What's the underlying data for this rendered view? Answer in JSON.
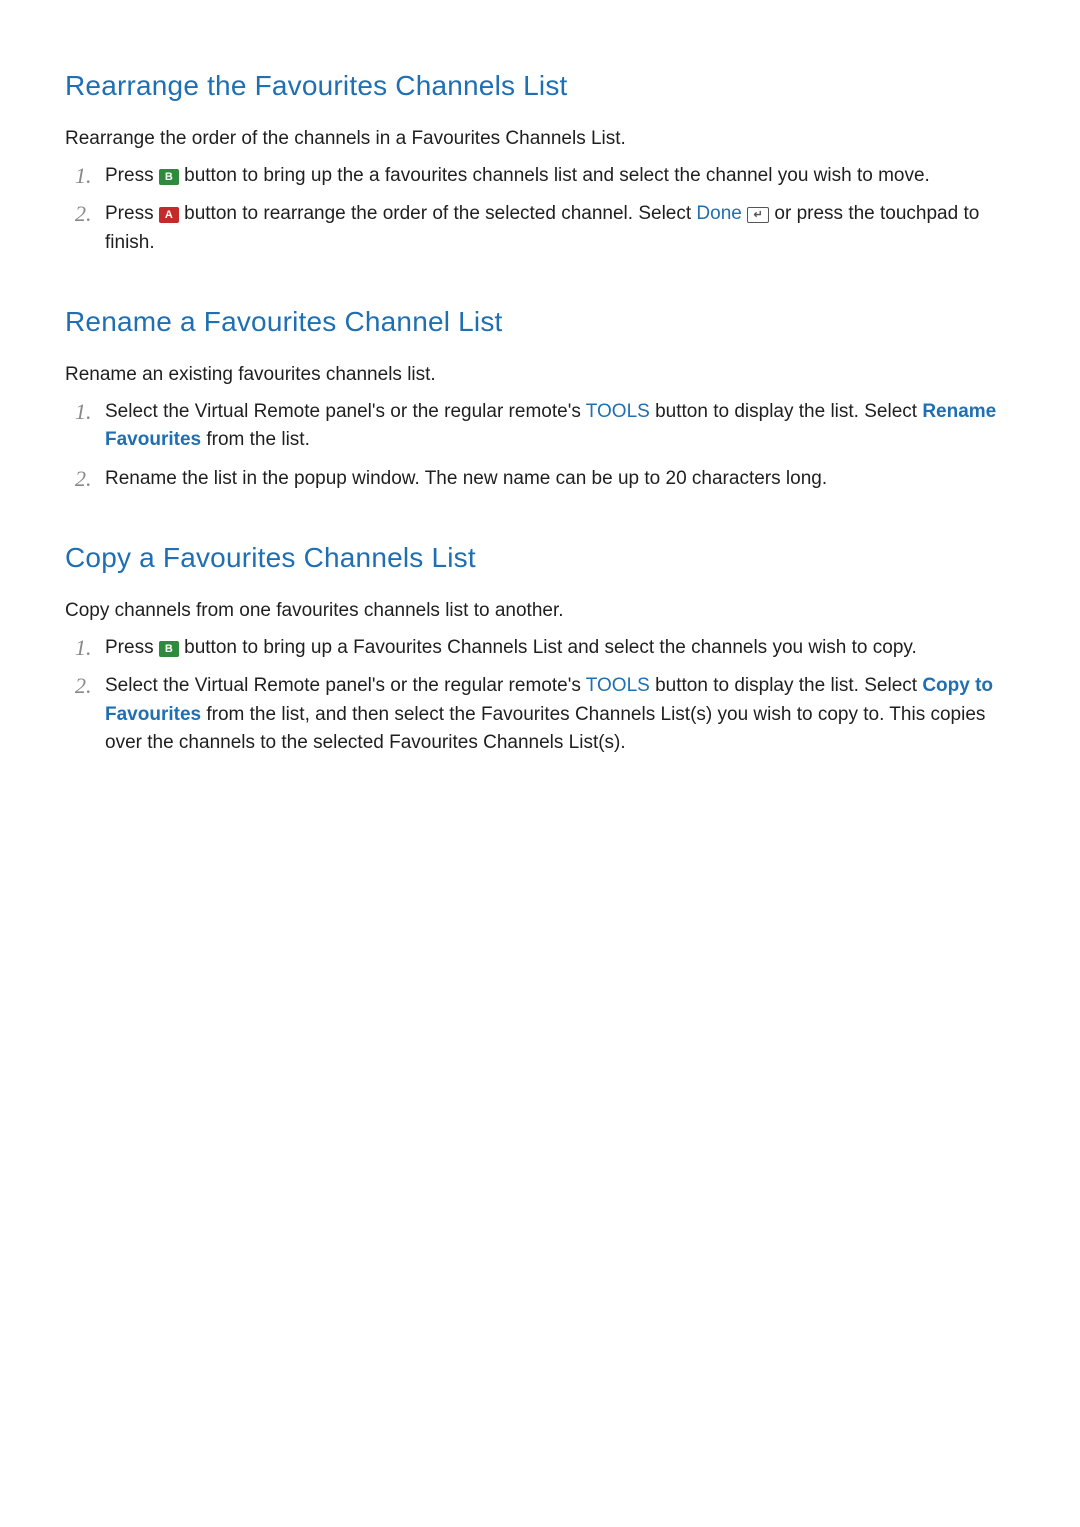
{
  "colors": {
    "heading": "#1f6fb2",
    "keyword_blue": "#1f6fb2",
    "btn_green": "#2e8b3d",
    "btn_red": "#c42a2a"
  },
  "sections": {
    "rearrange": {
      "heading": "Rearrange the Favourites Channels List",
      "intro": "Rearrange the order of the channels in a Favourites Channels List.",
      "step1": {
        "num": "1.",
        "t1": "Press ",
        "btnB": "B",
        "t2": " button to bring up the a favourites channels list and select the channel you wish to move."
      },
      "step2": {
        "num": "2.",
        "t1": "Press ",
        "btnA": "A",
        "t2": " button to rearrange the order of the selected channel. Select ",
        "done": "Done",
        "enter_glyph": "↵",
        "t3": " or press the touchpad to finish."
      }
    },
    "rename": {
      "heading": "Rename a Favourites Channel List",
      "intro": "Rename an existing favourites channels list.",
      "step1": {
        "num": "1.",
        "t1": "Select the Virtual Remote panel's or the regular remote's ",
        "tools": "TOOLS",
        "t2": " button to display the list. Select ",
        "rename_fav": "Rename Favourites",
        "t3": " from the list."
      },
      "step2": {
        "num": "2.",
        "text": "Rename the list in the popup window. The new name can be up to 20 characters long."
      }
    },
    "copy": {
      "heading": "Copy a Favourites Channels List",
      "intro": "Copy channels from one favourites channels list to another.",
      "step1": {
        "num": "1.",
        "t1": "Press ",
        "btnB": "B",
        "t2": " button to bring up a Favourites Channels List and select the channels you wish to copy."
      },
      "step2": {
        "num": "2.",
        "t1": "Select the Virtual Remote panel's or the regular remote's ",
        "tools": "TOOLS",
        "t2": " button to display the list. Select ",
        "copy_to": "Copy to Favourites",
        "t3": " from the list, and then select the Favourites Channels List(s) you wish to copy to. This copies over the channels to the selected Favourites Channels List(s)."
      }
    }
  }
}
